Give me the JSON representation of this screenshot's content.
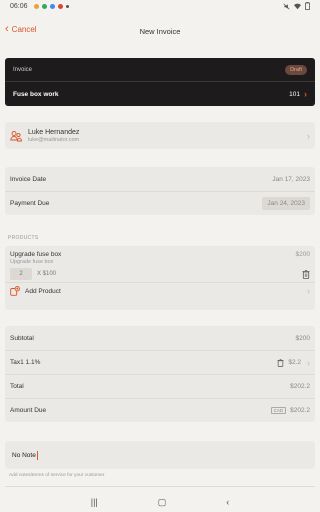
{
  "status_bar": {
    "time": "06:06"
  },
  "nav": {
    "cancel_label": "Cancel",
    "title": "New Invoice"
  },
  "header": {
    "label": "Invoice",
    "status": "Draft",
    "title": "Fuse box work",
    "number": "101"
  },
  "client": {
    "name": "Luke Hernandez",
    "email": "luke@mailinator.com"
  },
  "dates": {
    "invoice_date_label": "Invoice Date",
    "invoice_date": "Jan 17, 2023",
    "payment_due_label": "Payment Due",
    "payment_due": "Jan 24, 2023"
  },
  "products": {
    "section_label": "PRODUCTS",
    "items": [
      {
        "name": "Upgrade fuse box",
        "price": "$200",
        "description": "Upgrade fuse box",
        "qty": "2",
        "unit_price": "X  $100"
      }
    ],
    "add_label": "Add Product"
  },
  "totals": {
    "subtotal_label": "Subtotal",
    "subtotal": "$200",
    "tax_label": "Tax1 1.1%",
    "tax": "$2.2",
    "total_label": "Total",
    "total": "$202.2",
    "amount_due_label": "Amount Due",
    "currency": "CAD",
    "amount_due": "$202.2"
  },
  "notes": {
    "value": "No Note",
    "help": "Add notes/terms of service for your customer"
  },
  "colors": {
    "accent": "#d9552b",
    "dark_card": "#1d1b1b",
    "background": "#f4f2ef"
  }
}
